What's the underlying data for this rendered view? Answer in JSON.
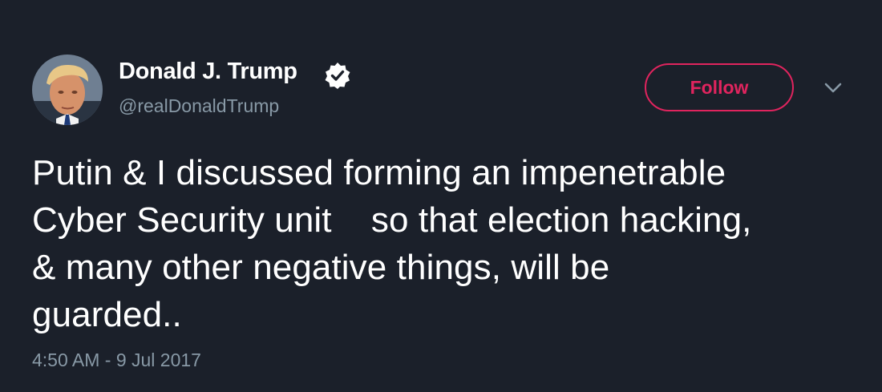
{
  "user": {
    "display_name": "Donald J. Trump",
    "handle": "@realDonaldTrump",
    "verified": true
  },
  "actions": {
    "follow_label": "Follow",
    "menu_icon": "chevron-down-icon"
  },
  "tweet": {
    "lines": [
      "Putin & I discussed forming an impenetrable",
      "Cyber Security unit    so that election hacking,",
      "& many other negative things, will be",
      "guarded.."
    ],
    "timestamp": "4:50 AM - 9 Jul 2017"
  },
  "colors": {
    "background": "#1b202a",
    "text": "#ffffff",
    "muted": "#8899a6",
    "follow_accent": "#e0245e"
  }
}
